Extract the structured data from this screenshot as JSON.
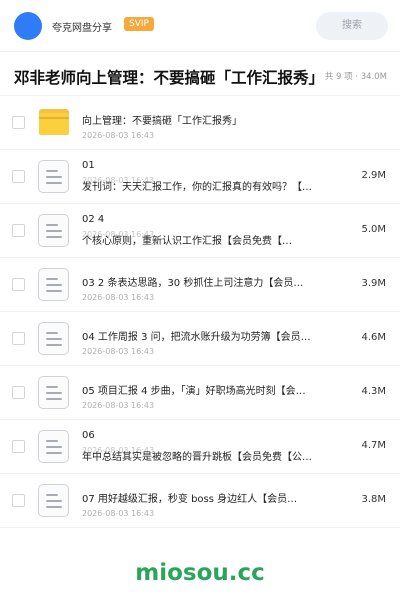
{
  "header": {
    "share_name": "夸克网盘分享",
    "vip_label": "SVIP",
    "search_label": "搜索"
  },
  "folder": {
    "title": "邓非老师向上管理：不要搞砸「工作汇报秀」",
    "meta": "共 9 项 · 34.0M"
  },
  "items": [
    {
      "type": "folder",
      "name": "向上管理：不要搞砸「工作汇报秀」",
      "name2": "",
      "date": "2026-08-03 16:43",
      "size": ""
    },
    {
      "type": "file",
      "name": "01",
      "name2": "发刊词：天天汇报工作，你的汇报真的有效吗？【…",
      "date": "2026-08-03 16:43",
      "size": "2.9M"
    },
    {
      "type": "file",
      "name": "02 4",
      "name2": "个核心原则，重新认识工作汇报【会员免费【…",
      "date": "2026-08-03 16:43",
      "size": "5.0M"
    },
    {
      "type": "file",
      "name": "03 2 条表达思路，30 秒抓住上司注意力【会员…",
      "name2": "",
      "date": "2026-08-03 16:43",
      "size": "3.9M"
    },
    {
      "type": "file",
      "name": "04 工作周报 3 问，把流水账升级为功劳簿【会员…",
      "name2": "",
      "date": "2026-08-03 16:43",
      "size": "4.6M"
    },
    {
      "type": "file",
      "name": "05 项目汇报 4 步曲，「演」好职场高光时刻【会…",
      "name2": "",
      "date": "2026-08-03 16:43",
      "size": "4.3M"
    },
    {
      "type": "file",
      "name": "06",
      "name2": "年中总结其实是被忽略的晋升跳板【会员免费【公…",
      "date": "2026-08-03 16:43",
      "size": "4.7M"
    },
    {
      "type": "file",
      "name": "07 用好越级汇报，秒变 boss 身边红人【会员…",
      "name2": "",
      "date": "2026-08-03 16:43",
      "size": "3.8M"
    }
  ],
  "watermark": "miosou.cc",
  "colors": {
    "accent": "#2f7cf6",
    "vip": "#f7a83b",
    "folder": "#fccf3f",
    "watermark": "#2aa55a"
  }
}
